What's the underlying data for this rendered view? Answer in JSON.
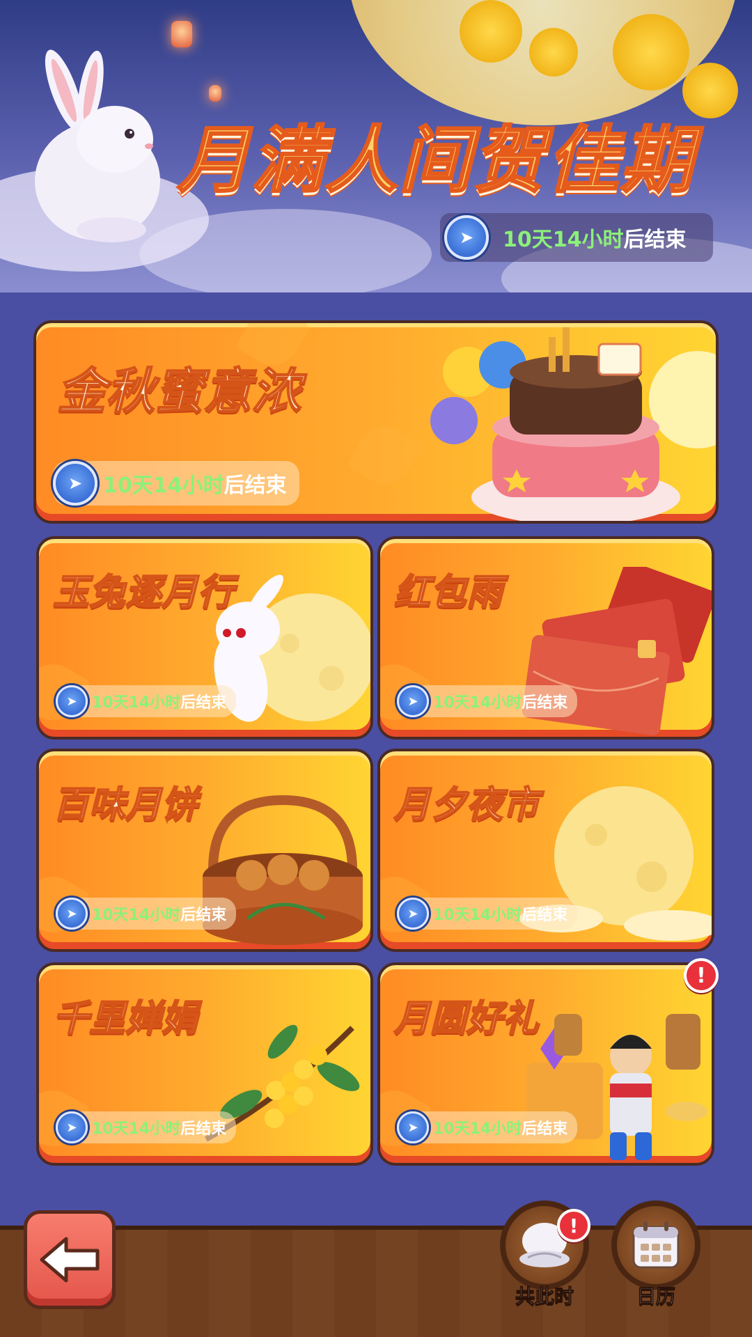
{
  "banner": {
    "title": "月满人间贺佳期",
    "timer": {
      "time": "10天14小时",
      "suffix": "后结束"
    }
  },
  "featured": {
    "title": "金秋蜜意浓",
    "timer": {
      "time": "10天14小时",
      "suffix": "后结束"
    }
  },
  "events": [
    {
      "title": "玉兔逐月行",
      "time": "10天14小时",
      "suffix": "后结束"
    },
    {
      "title": "红包雨",
      "time": "10天14小时",
      "suffix": "后结束"
    },
    {
      "title": "百味月饼",
      "time": "10天14小时",
      "suffix": "后结束"
    },
    {
      "title": "月夕夜市",
      "time": "10天14小时",
      "suffix": "后结束"
    },
    {
      "title": "千里婵娟",
      "time": "10天14小时",
      "suffix": "后结束"
    },
    {
      "title": "月圆好礼",
      "time": "10天14小时",
      "suffix": "后结束",
      "alert": "!"
    }
  ],
  "bottom": {
    "share_label": "共此时",
    "share_alert": "!",
    "calendar_label": "日历"
  },
  "icons": {
    "timer": "clock-icon",
    "back": "back-arrow-icon",
    "share": "mooncake-bowl-icon",
    "calendar": "calendar-icon",
    "alert": "exclamation-icon"
  }
}
